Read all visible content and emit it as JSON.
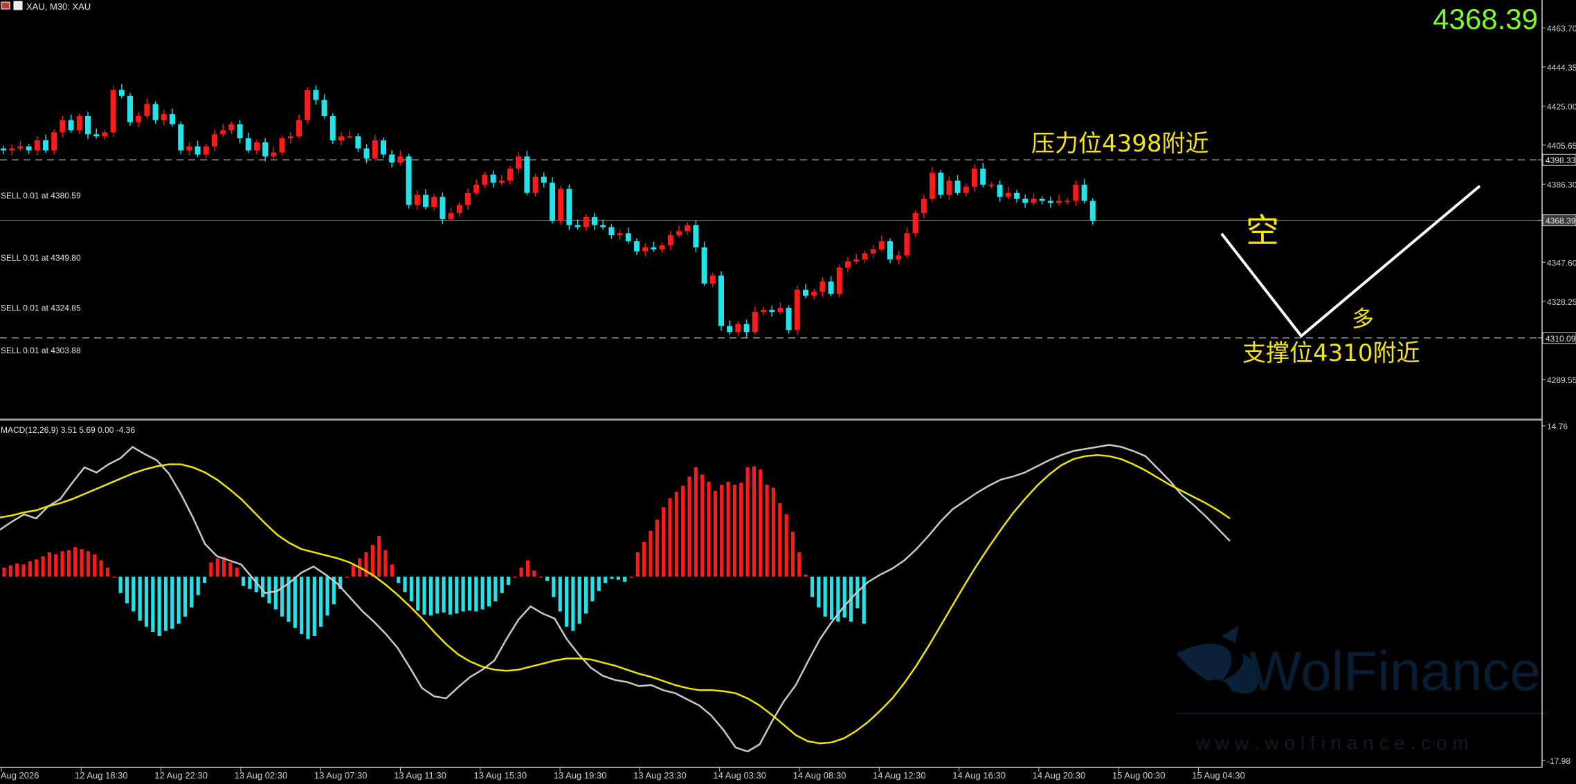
{
  "header": {
    "symbol_text": "XAU, M30: XAU",
    "price_big": "4368.39"
  },
  "colors": {
    "bull": "#ff1a1a",
    "bear": "#22e3ea",
    "signal": "#f2e600",
    "macd_line": "#c9c9c9",
    "axis_text": "#d0d0d0",
    "annotation": "#f5e31a",
    "price_big": "#7cfc2a"
  },
  "annotations": {
    "resistance": "压力位4398附近",
    "support": "支撑位4310附近",
    "short": "空",
    "long": "多"
  },
  "watermark": {
    "brand": "WolFinance",
    "url": "w w w . w o l f i n a n c e . c o m"
  },
  "chart_data": [
    {
      "type": "candlestick",
      "title": "XAU, M30",
      "ylim": [
        4272,
        4470
      ],
      "y_ticks": [
        "4463.70",
        "4444.35",
        "4425.00",
        "4405.65",
        "4386.30",
        "4347.60",
        "4328.25",
        "4289.55"
      ],
      "current_price": 4368.39,
      "current_price_label": "4368.39",
      "levels": [
        {
          "value": 4398.33,
          "label": "4398.33",
          "style": "dashed"
        },
        {
          "value": 4310.09,
          "label": "4310.09",
          "style": "dashed"
        },
        {
          "value": 4368.39,
          "label": "4368.39",
          "style": "solid"
        }
      ],
      "orders": [
        {
          "text": "SELL 0.01 at 4380.59",
          "value": 4380.59
        },
        {
          "text": "SELL 0.01 at 4349.80",
          "value": 4349.8
        },
        {
          "text": "SELL 0.01 at 4324.85",
          "value": 4324.85
        },
        {
          "text": "SELL 0.01 at 4303.88",
          "value": 4303.88
        }
      ],
      "x_labels": [
        "12 Aug 2026",
        "12 Aug 18:30",
        "12 Aug 22:30",
        "13 Aug 02:30",
        "13 Aug 07:30",
        "13 Aug 11:30",
        "13 Aug 15:30",
        "13 Aug 19:30",
        "13 Aug 23:30",
        "14 Aug 03:30",
        "14 Aug 08:30",
        "14 Aug 12:30",
        "14 Aug 16:30",
        "14 Aug 20:30",
        "15 Aug 00:30",
        "15 Aug 04:30"
      ],
      "closes": [
        4403,
        4404,
        4405,
        4403,
        4408,
        4403,
        4412,
        4418,
        4413,
        4420,
        4411,
        4410,
        4412,
        4433,
        4430,
        4417,
        4420,
        4426,
        4418,
        4421,
        4416,
        4403,
        4405,
        4401,
        4405,
        4411,
        4413,
        4416,
        4409,
        4403,
        4407,
        4400,
        4402,
        4409,
        4410,
        4418,
        4433,
        4428,
        4420,
        4408,
        4410,
        4410,
        4404,
        4399,
        4408,
        4401,
        4397,
        4400,
        4376,
        4381,
        4375,
        4380,
        4369,
        4372,
        4376,
        4382,
        4386,
        4391,
        4387,
        4388,
        4394,
        4400,
        4382,
        4390,
        4387,
        4368,
        4384,
        4366,
        4365,
        4370,
        4366,
        4365,
        4361,
        4362,
        4358,
        4353,
        4355,
        4354,
        4356,
        4361,
        4363,
        4366,
        4355,
        4337,
        4341,
        4316,
        4313,
        4317,
        4313,
        4323,
        4324,
        4323,
        4325,
        4314,
        4334,
        4331,
        4333,
        4338,
        4332,
        4345,
        4348,
        4349,
        4352,
        4354,
        4358,
        4349,
        4351,
        4362,
        4372,
        4379,
        4392,
        4381,
        4388,
        4382,
        4385,
        4394,
        4386,
        4386,
        4380,
        4382,
        4379,
        4377,
        4379,
        4378,
        4377,
        4378,
        4378,
        4386,
        4378,
        4368
      ]
    },
    {
      "type": "bar+line",
      "title": "MACD(12,26,9) 3.51 5.69 0.00 -4.36",
      "ylim": [
        -17.98,
        14.76
      ],
      "y_ticks": [
        "14.76",
        "-17.98"
      ],
      "series": [
        {
          "name": "MACD",
          "values": [
            4.6,
            5.4,
            6.1,
            5.7,
            6.9,
            7.6,
            9.2,
            10.7,
            10.2,
            11.0,
            11.6,
            12.7,
            12.0,
            11.4,
            10.1,
            8.1,
            5.8,
            3.2,
            2.0,
            1.6,
            1.2,
            -0.2,
            -1.6,
            -1.4,
            -0.6,
            0.4,
            1.0,
            0.2,
            -0.7,
            -2.0,
            -3.3,
            -4.4,
            -5.6,
            -7.0,
            -8.9,
            -10.9,
            -11.7,
            -11.9,
            -10.8,
            -9.8,
            -9.1,
            -8.2,
            -6.1,
            -4.2,
            -2.9,
            -3.6,
            -4.1,
            -6.1,
            -7.6,
            -8.9,
            -9.7,
            -10.1,
            -10.3,
            -10.7,
            -10.6,
            -11.1,
            -11.4,
            -12.0,
            -12.6,
            -13.6,
            -15.0,
            -16.7,
            -17.1,
            -16.4,
            -14.2,
            -12.2,
            -10.6,
            -8.3,
            -6.1,
            -4.4,
            -2.9,
            -1.6,
            -0.5,
            0.2,
            0.8,
            1.6,
            2.7,
            4.0,
            5.4,
            6.6,
            7.4,
            8.2,
            8.9,
            9.5,
            9.8,
            10.2,
            10.8,
            11.4,
            11.9,
            12.3,
            12.5,
            12.7,
            12.9,
            12.7,
            12.3,
            11.8,
            10.6,
            9.4,
            8.0,
            7.0,
            5.9,
            4.7,
            3.5
          ]
        },
        {
          "name": "Signal",
          "values": [
            5.8,
            6.0,
            6.3,
            6.5,
            6.9,
            7.2,
            7.6,
            8.1,
            8.6,
            9.1,
            9.6,
            10.1,
            10.5,
            10.8,
            11.0,
            11.0,
            10.7,
            10.2,
            9.5,
            8.6,
            7.6,
            6.4,
            5.2,
            4.1,
            3.3,
            2.7,
            2.4,
            2.1,
            1.8,
            1.4,
            0.8,
            0.1,
            -0.8,
            -1.8,
            -2.9,
            -4.1,
            -5.4,
            -6.6,
            -7.6,
            -8.3,
            -8.8,
            -9.1,
            -9.2,
            -9.1,
            -8.8,
            -8.5,
            -8.2,
            -8.0,
            -8.0,
            -8.1,
            -8.4,
            -8.7,
            -9.1,
            -9.5,
            -9.8,
            -10.2,
            -10.6,
            -10.9,
            -11.1,
            -11.1,
            -11.2,
            -11.4,
            -11.9,
            -12.6,
            -13.5,
            -14.5,
            -15.5,
            -16.1,
            -16.3,
            -16.2,
            -15.8,
            -15.1,
            -14.2,
            -13.1,
            -11.9,
            -10.4,
            -8.7,
            -6.8,
            -4.8,
            -2.8,
            -0.8,
            1.1,
            2.9,
            4.6,
            6.2,
            7.6,
            8.9,
            10.0,
            10.9,
            11.5,
            11.8,
            11.9,
            11.8,
            11.5,
            11.0,
            10.4,
            9.7,
            9.0,
            8.4,
            7.8,
            7.2,
            6.5,
            5.7
          ]
        },
        {
          "name": "Histogram",
          "values": [
            0.9,
            1.1,
            1.3,
            1.2,
            1.5,
            1.7,
            2.0,
            2.4,
            2.2,
            2.5,
            2.6,
            2.9,
            2.7,
            2.5,
            2.2,
            1.6,
            0.9,
            0.0,
            -1.6,
            -2.6,
            -3.4,
            -4.3,
            -4.9,
            -5.4,
            -5.8,
            -5.3,
            -5.1,
            -4.6,
            -3.9,
            -3.0,
            -1.8,
            -0.6,
            1.4,
            1.8,
            1.9,
            1.4,
            0.9,
            -0.9,
            -1.2,
            -1.5,
            -2.0,
            -2.6,
            -3.2,
            -3.9,
            -4.4,
            -5.0,
            -5.6,
            -6.1,
            -5.8,
            -4.9,
            -3.8,
            -2.7,
            -1.2,
            0.0,
            1.1,
            1.8,
            2.4,
            3.1,
            4.0,
            2.6,
            1.2,
            -0.6,
            -1.5,
            -2.4,
            -3.3,
            -3.7,
            -3.8,
            -3.6,
            -3.5,
            -3.7,
            -3.6,
            -3.4,
            -3.3,
            -3.4,
            -3.2,
            -2.9,
            -2.4,
            -1.6,
            -0.8,
            0.0,
            0.9,
            1.6,
            0.6,
            0.0,
            -0.4,
            -2.0,
            -3.4,
            -4.9,
            -5.3,
            -4.6,
            -3.6,
            -2.4,
            -1.4,
            -0.6,
            -0.2,
            -0.3,
            -0.5,
            0.0,
            2.4,
            3.4,
            4.5,
            5.6,
            6.8,
            7.7,
            8.3,
            8.9,
            9.8,
            10.7,
            10.0,
            9.3,
            8.4,
            9.0,
            9.3,
            9.0,
            9.2,
            10.7,
            10.8,
            10.5,
            9.0,
            8.7,
            7.2,
            6.1,
            4.4,
            2.4,
            0.2,
            -2.0,
            -3.0,
            -3.9,
            -4.2,
            -4.4,
            -4.0,
            -4.4,
            -3.1,
            -4.6
          ]
        }
      ]
    }
  ]
}
